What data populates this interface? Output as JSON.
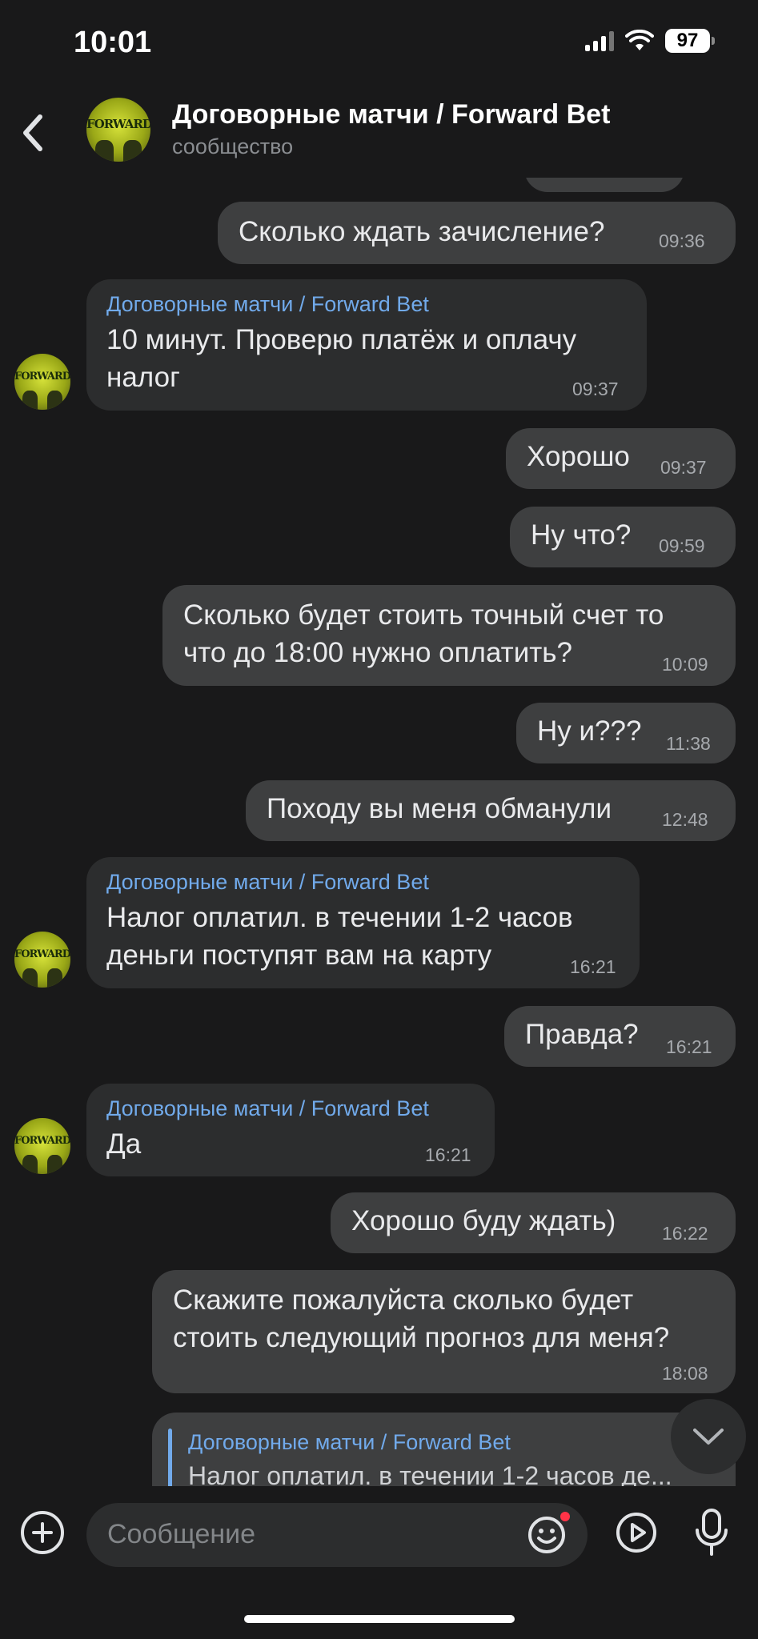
{
  "status_bar": {
    "time": "10:01",
    "battery": "97"
  },
  "header": {
    "title": "Договорные матчи / Forward Bet",
    "subtitle": "сообщество",
    "avatar_text": "FORWARD"
  },
  "messages": [
    {
      "text": "Сколько ждать зачисление?",
      "time": "09:36"
    },
    {
      "sender": "Договорные матчи / Forward Bet",
      "text": "10 минут. Проверю платёж и оплачу\nналог",
      "time": "09:37"
    },
    {
      "text": "Хорошо",
      "time": "09:37"
    },
    {
      "text": "Ну что?",
      "time": "09:59"
    },
    {
      "text": "Сколько будет стоить точный счет то\nчто до 18:00 нужно оплатить?",
      "time": "10:09"
    },
    {
      "text": "Ну и???",
      "time": "11:38"
    },
    {
      "text": "Походу вы меня обманули",
      "time": "12:48"
    },
    {
      "sender": "Договорные матчи / Forward Bet",
      "text": "Налог оплатил. в течении 1-2 часов\nденьги поступят вам на карту",
      "time": "16:21"
    },
    {
      "text": "Правда?",
      "time": "16:21"
    },
    {
      "sender": "Договорные матчи / Forward Bet",
      "text": "Да",
      "time": "16:21"
    },
    {
      "text": "Хорошо буду ждать)",
      "time": "16:22"
    },
    {
      "text": "Скажите пожалуйста сколько будет\nстоить следующий прогноз для меня?",
      "time": "18:08"
    },
    {
      "reply_sender": "Договорные матчи / Forward Bet",
      "reply_text": "Налог оплатил. в течении 1-2 часов де..."
    }
  ],
  "composer": {
    "placeholder": "Сообщение"
  },
  "icons": {
    "back": "chevron-left-icon",
    "attach": "plus-circle-icon",
    "emoji": "smile-icon",
    "video": "play-circle-icon",
    "mic": "microphone-icon",
    "scroll": "chevron-down-icon"
  },
  "colors": {
    "accent": "#71aaeb",
    "badge": "#ff3347",
    "background": "#19191a"
  }
}
